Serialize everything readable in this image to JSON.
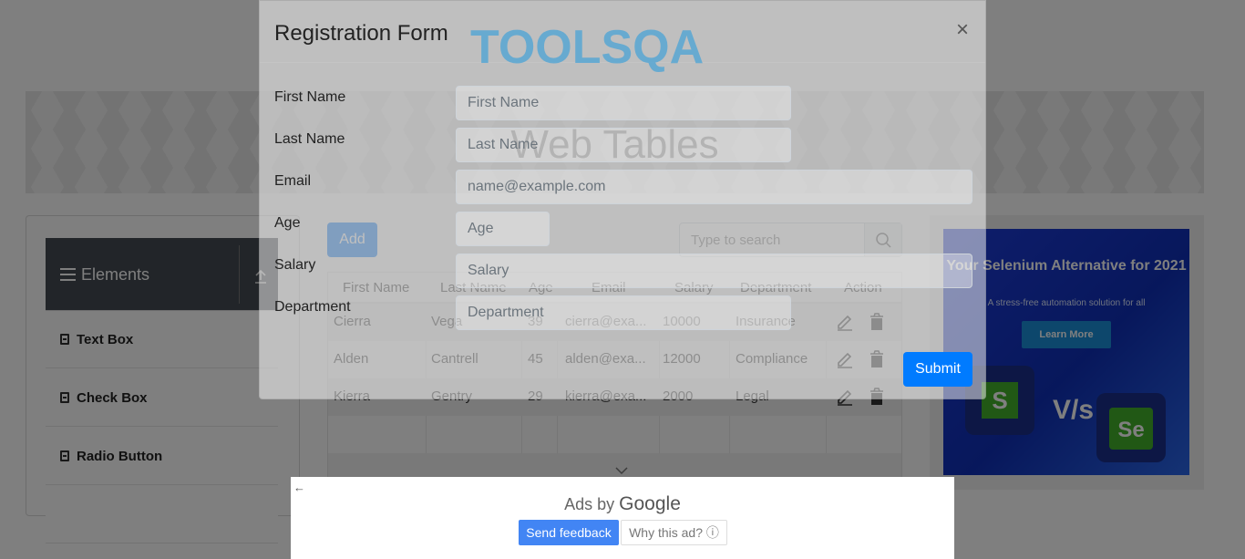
{
  "page": {
    "banner_title": "Web Tables",
    "sidebar": {
      "group_title": "Elements",
      "items": [
        {
          "label": "Text Box"
        },
        {
          "label": "Check Box"
        },
        {
          "label": "Radio Button"
        }
      ]
    },
    "add_label": "Add",
    "search": {
      "placeholder": "Type to search"
    },
    "table": {
      "headers": [
        "First Name",
        "Last Name",
        "Age",
        "Email",
        "Salary",
        "Department",
        "Action"
      ],
      "rows": [
        [
          "Cierra",
          "Vega",
          "39",
          "cierra@exa...",
          "10000",
          "Insurance"
        ],
        [
          "Alden",
          "Cantrell",
          "45",
          "alden@exa...",
          "12000",
          "Compliance"
        ],
        [
          "Kierra",
          "Gentry",
          "29",
          "kierra@exa...",
          "2000",
          "Legal"
        ]
      ]
    },
    "ad": {
      "headline": "Your Selenium Alternative for 2021",
      "subline": "A stress-free automation solution for all",
      "cta": "Learn More",
      "vs": "V/s",
      "logo_left": "S",
      "logo_right": "Se"
    }
  },
  "modal": {
    "title": "Registration Form",
    "brand": "TOOLSQA",
    "close": "×",
    "fields": [
      {
        "label": "First Name",
        "placeholder": "First Name"
      },
      {
        "label": "Last Name",
        "placeholder": "Last Name"
      },
      {
        "label": "Email",
        "placeholder": "name@example.com"
      },
      {
        "label": "Age",
        "placeholder": "Age"
      },
      {
        "label": "Salary",
        "placeholder": "Salary"
      },
      {
        "label": "Department",
        "placeholder": "Department"
      }
    ],
    "submit": "Submit"
  },
  "google_ads": {
    "back": "←",
    "ads_by": "Ads by",
    "brand": "Google",
    "send_feedback": "Send feedback",
    "why": "Why this ad? ⓘ"
  }
}
